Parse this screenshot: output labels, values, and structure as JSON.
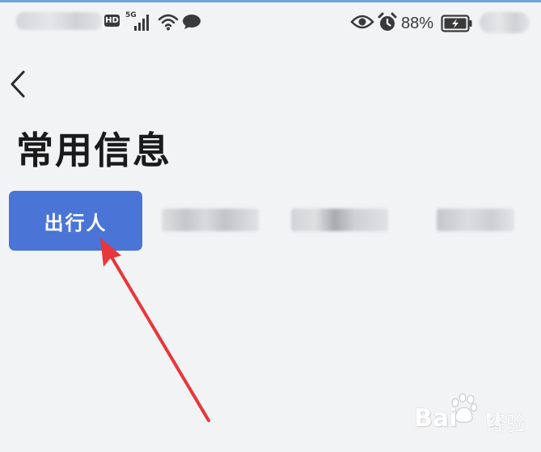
{
  "status_bar": {
    "network_badge": "HD",
    "network_type": "5G",
    "battery_percent": "88%",
    "icons": [
      "signal-icon",
      "wifi-icon",
      "message-icon",
      "eye-icon",
      "alarm-icon",
      "battery-charging-icon"
    ]
  },
  "header": {
    "back_icon": "chevron-left-icon",
    "title": "常用信息"
  },
  "tabs": [
    {
      "label": "出行人",
      "active": true
    },
    {
      "label": "",
      "active": false,
      "obscured": true
    },
    {
      "label": "",
      "active": false,
      "obscured": true
    },
    {
      "label": "",
      "active": false,
      "obscured": true
    }
  ],
  "annotation": {
    "arrow_color": "#e8363b"
  },
  "watermark": {
    "brand": "Bai",
    "brand_tail": "u",
    "suffix": "经验"
  },
  "colors": {
    "accent": "#4a74d6",
    "background": "#f2f3f5"
  }
}
